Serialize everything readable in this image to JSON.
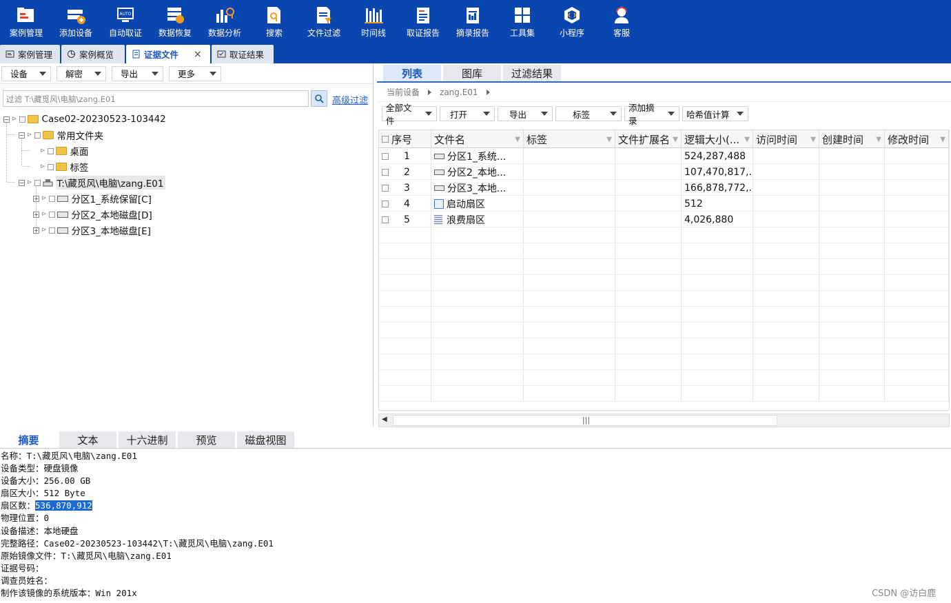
{
  "toolbar": {
    "items": [
      {
        "label": "案例管理",
        "icon": "case-icon"
      },
      {
        "label": "添加设备",
        "icon": "add-device-icon"
      },
      {
        "label": "自动取证",
        "icon": "auto-icon"
      },
      {
        "label": "数据恢复",
        "icon": "recovery-icon"
      },
      {
        "label": "数据分析",
        "icon": "analysis-icon"
      },
      {
        "label": "搜索",
        "icon": "search-doc-icon"
      },
      {
        "label": "文件过滤",
        "icon": "file-filter-icon"
      },
      {
        "label": "时间线",
        "icon": "timeline-icon"
      },
      {
        "label": "取证报告",
        "icon": "report-icon"
      },
      {
        "label": "摘录报告",
        "icon": "excerpt-report-icon"
      },
      {
        "label": "工具集",
        "icon": "toolset-icon"
      },
      {
        "label": "小程序",
        "icon": "miniprogram-icon"
      },
      {
        "label": "客服",
        "icon": "support-icon"
      }
    ]
  },
  "tabs": [
    {
      "label": "案例管理"
    },
    {
      "label": "案例概览"
    },
    {
      "label": "证据文件",
      "close": "×"
    },
    {
      "label": "取证结果"
    }
  ],
  "left": {
    "dropdowns": [
      "设备",
      "解密",
      "导出",
      "更多"
    ],
    "filter_placeholder": "过滤 T:\\藏觅风\\电脑\\zang.E01",
    "advanced_filter": "高级过滤",
    "tree": {
      "case": "Case02-20230523-103442",
      "common_folder": "常用文件夹",
      "desktop": "桌面",
      "tags": "标签",
      "image": "T:\\藏觅风\\电脑\\zang.E01",
      "partitions": [
        "分区1_系统保留[C]",
        "分区2_本地磁盘[D]",
        "分区3_本地磁盘[E]"
      ]
    }
  },
  "right": {
    "tabs": [
      "列表",
      "图库",
      "过滤结果"
    ],
    "breadcrumb": {
      "current": "当前设备",
      "item": "zang.E01"
    },
    "dropdowns": [
      "全部文件",
      "打开",
      "导出",
      "标签",
      "添加摘录",
      "哈希值计算"
    ],
    "columns": [
      "序号",
      "文件名",
      "标签",
      "文件扩展名",
      "逻辑大小(...",
      "访问时间",
      "创建时间",
      "修改时间"
    ],
    "rows": [
      {
        "no": "1",
        "name": "分区1_系统...",
        "size": "524,287,488"
      },
      {
        "no": "2",
        "name": "分区2_本地...",
        "size": "107,470,817,..."
      },
      {
        "no": "3",
        "name": "分区3_本地...",
        "size": "166,878,772,..."
      },
      {
        "no": "4",
        "name": "启动扇区",
        "size": "512"
      },
      {
        "no": "5",
        "name": "浪费扇区",
        "size": "4,026,880"
      }
    ],
    "scroll_grip": "|||"
  },
  "bottom": {
    "tabs": [
      "摘要",
      "文本",
      "十六进制",
      "预览",
      "磁盘视图"
    ],
    "lines": [
      {
        "k": "名称：",
        "v": "T:\\藏觅风\\电脑\\zang.E01"
      },
      {
        "k": "设备类型：",
        "v": "硬盘镜像"
      },
      {
        "k": "设备大小：",
        "v": "256.00 GB"
      },
      {
        "k": "扇区大小：",
        "v": "512 Byte"
      },
      {
        "k": "扇区数：",
        "v": "536,870,912"
      },
      {
        "k": "物理位置：",
        "v": "0"
      },
      {
        "k": "设备描述：",
        "v": "本地硬盘"
      },
      {
        "k": "完整路径：",
        "v": "Case02-20230523-103442\\T:\\藏觅风\\电脑\\zang.E01"
      },
      {
        "k": "原始镜像文件：",
        "v": "T:\\藏觅风\\电脑\\zang.E01"
      },
      {
        "k": "证据号码：",
        "v": ""
      },
      {
        "k": "调查员姓名：",
        "v": ""
      },
      {
        "k": "制作该镜像的系统版本：",
        "v": "Win 201x"
      }
    ]
  },
  "watermark": "CSDN @访白鹿",
  "colors": {
    "toolbar_bg": "#0a46b0",
    "accent": "#1b57c2",
    "selection": "#1a69d6"
  }
}
